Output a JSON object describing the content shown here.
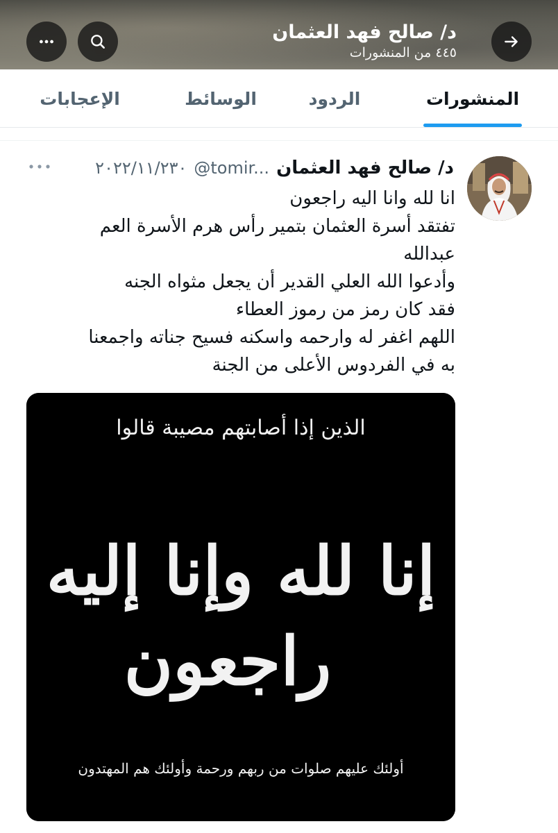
{
  "header": {
    "name": "د/ صالح فهد العثمان",
    "posts_count": "٤٤٥ من المنشورات",
    "back_icon": "arrow-right-icon",
    "search_icon": "search-icon",
    "more_icon": "more-horizontal-icon"
  },
  "tabs": [
    {
      "label": "المنشورات",
      "active": true
    },
    {
      "label": "الردود",
      "active": false
    },
    {
      "label": "الوسائط",
      "active": false
    },
    {
      "label": "الإعجابات",
      "active": false
    }
  ],
  "tweet": {
    "author_name": "د/ صالح فهد العثمان",
    "handle": "@tomir...",
    "date": "٢٠٢٢/١١/٢٣٠",
    "lines": [
      "انا لله وانا اليه راجعون",
      "تفتقد أسرة العثمان بتمير رأس هرم الأسرة العم",
      "عبدالله",
      "وأدعوا الله العلي القدير أن يجعل مثواه الجنه",
      "فقد كان رمز من رموز العطاء",
      "اللهم اغفر له وارحمه واسكنه فسيح جناته واجمعنا",
      "به في الفردوس الأعلى من الجنة"
    ],
    "image": {
      "top_line": "الذين إذا أصابتهم مصيبة قالوا",
      "main_line_1": "إنا لله وإنا إليه",
      "main_line_2": "راجعون",
      "bottom_line": "أولئك عليهم صلوات من ربهم ورحمة وأولئك هم المهتدون"
    }
  }
}
